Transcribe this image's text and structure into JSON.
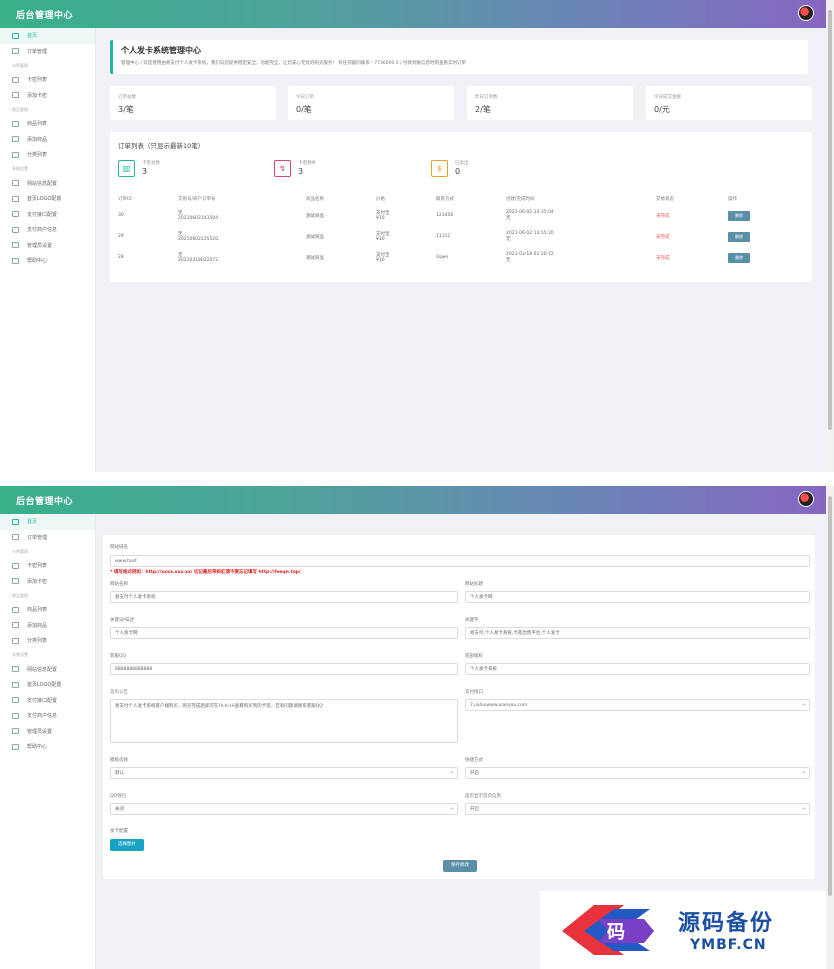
{
  "app": {
    "brand": "后台管理中心"
  },
  "sidebar": [
    {
      "type": "item",
      "label": "首页",
      "active": true
    },
    {
      "type": "item",
      "label": "订单管理"
    },
    {
      "type": "group",
      "label": "卡密管理"
    },
    {
      "type": "item",
      "label": "卡密列表"
    },
    {
      "type": "item",
      "label": "添加卡密"
    },
    {
      "type": "group",
      "label": "商品管理"
    },
    {
      "type": "item",
      "label": "商品列表"
    },
    {
      "type": "item",
      "label": "添加商品"
    },
    {
      "type": "item",
      "label": "分类列表"
    },
    {
      "type": "group",
      "label": "系统设置"
    },
    {
      "type": "item",
      "label": "网站信息配置"
    },
    {
      "type": "item",
      "label": "首页LOGO配置"
    },
    {
      "type": "item",
      "label": "支付接口配置"
    },
    {
      "type": "item",
      "label": "支付商户信息"
    },
    {
      "type": "item",
      "label": "管理员设置"
    },
    {
      "type": "item",
      "label": "帮助中心"
    }
  ],
  "dashboard": {
    "notice": {
      "title": "个人发卡系统管理中心",
      "desc": "管理中心 / 欢迎使用由易支付个人发卡系统，我们向您提供稳定安全，功能完全，让您安心无忧的购买服务！ 有任何疑问联系：7736000 0    /    付款到账信息时刻查看实时订单"
    },
    "stats": [
      {
        "label": "订单总数",
        "value": "3/笔"
      },
      {
        "label": "今日订单",
        "value": "0/笔"
      },
      {
        "label": "昨日订单数",
        "value": "2/笔"
      },
      {
        "label": "今日成交金额",
        "value": "0/元"
      }
    ],
    "orders": {
      "title": "订单列表（只显示最新10笔）",
      "mini": [
        {
          "label": "卡密总数",
          "value": "3",
          "icon": "bar-chart-icon",
          "color": "#23b7a3"
        },
        {
          "label": "卡密剩余",
          "value": "3",
          "icon": "wallet-icon",
          "color": "#e0436b"
        },
        {
          "label": "已卖出",
          "value": "0",
          "icon": "dollar-icon",
          "color": "#f0a030"
        }
      ],
      "columns": [
        "订单ID",
        "交易号/商户订单号",
        "商品名称",
        "价格",
        "联系方式",
        "创建/完成时间",
        "交易状态",
        "操作"
      ],
      "rows": [
        {
          "id": "30",
          "trade": "无",
          "sub": "20210602143504",
          "name": "测试商品",
          "pay": "支付宝",
          "price": "¥10",
          "contact": "123456",
          "time1": "2021-06-02 14:35:04",
          "time2": "无",
          "status": "未完成",
          "op": "删除"
        },
        {
          "id": "29",
          "trade": "无",
          "sub": "20210602135520",
          "name": "测试商品",
          "pay": "支付宝",
          "price": "¥10",
          "contact": "11111",
          "time1": "2021-06-02 13:55:20",
          "time2": "无",
          "status": "未完成",
          "op": "删除"
        },
        {
          "id": "28",
          "trade": "无",
          "sub": "20210318022072",
          "name": "测试商品",
          "pay": "支付宝",
          "price": "¥10",
          "contact": "2qwe",
          "time1": "2021-03-18 02:20:72",
          "time2": "无",
          "status": "未完成",
          "op": "删除"
        }
      ]
    }
  },
  "settings": {
    "site_url_label": "网站域名",
    "site_url_value": "www.host",
    "warning": "* 填写格式例如：http://xxxx.xxx.xx/ 切记最后带斜杠请不要忘记填写 http://feeqn.top/",
    "site_name_label": "网站名称",
    "site_name_value": "易支付个人发卡系统",
    "site_title_label": "网站标题",
    "site_title_value": "个人发卡网",
    "keywords_label": "关键词/描述",
    "keywords_value": "个人发卡网",
    "keywords2_label": "关键字",
    "keywords2_value": "易支付,个人发卡系统,卡密出售平台,个人发卡",
    "qq_label": "客服QQ",
    "qq_value": "8888888888888",
    "footer_label": "底部版权",
    "footer_value": "个人发卡系统",
    "notice_label": "首页公告",
    "notice_value": "易支付个人发卡系统客户端购买，购买完成后即可在Hi·hi·Hi查看购买到的卡密，若有问题请联系客服QQ",
    "gateway_label": "支付接口",
    "gateway_value": "7.jiahuiwww.xiaoyou.com",
    "mode_label": "模板选择",
    "mode_value": "默认",
    "alipay_label": "快捷方式",
    "alipay_value": "开启",
    "qqpay_label": "QQ钱包",
    "qqpay_value": "关闭",
    "wxpay_label": "是否显示首页信息",
    "wxpay_value": "开启",
    "logo_label": "发卡配置",
    "upload_button": "选择图片",
    "save_button": "保存修改"
  },
  "watermark": {
    "glyph": "码",
    "title": "源码备份",
    "sub": "YMBF.CN"
  }
}
